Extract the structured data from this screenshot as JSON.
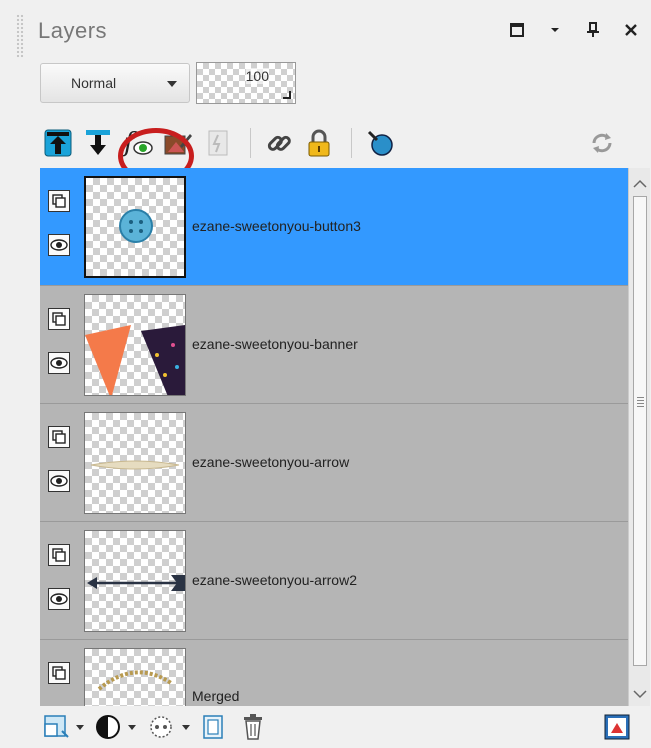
{
  "panel": {
    "title": "Layers",
    "window_buttons": [
      "maximize-icon",
      "dropdown-icon",
      "pin-icon",
      "close-icon"
    ]
  },
  "blend": {
    "mode": "Normal",
    "opacity": "100"
  },
  "toolbar": {
    "icons": [
      "raise-layer-icon",
      "lower-layer-icon",
      "layer-styles-icon",
      "edit-selection-icon",
      "lock-transparency-icon",
      "link-icon",
      "lock-icon",
      "ball-icon",
      "refresh-icon"
    ]
  },
  "layers": [
    {
      "name": "ezane-sweetonyou-button3",
      "selected": true,
      "thumb": "button"
    },
    {
      "name": "ezane-sweetonyou-banner",
      "selected": false,
      "thumb": "banner"
    },
    {
      "name": "ezane-sweetonyou-arrow",
      "selected": false,
      "thumb": "arrow"
    },
    {
      "name": "ezane-sweetonyou-arrow2",
      "selected": false,
      "thumb": "arrow2"
    },
    {
      "name": "Merged",
      "selected": false,
      "thumb": "merged"
    }
  ],
  "colors": {
    "selection": "#3399ff",
    "highlight_ring": "#c81e1e",
    "row_bg": "#b5b5b5"
  },
  "bottom_toolbar": {
    "icons": [
      "new-layer-icon",
      "mask-icon",
      "link-layers-icon",
      "group-icon",
      "delete-icon",
      "edit-layer-icon"
    ]
  }
}
